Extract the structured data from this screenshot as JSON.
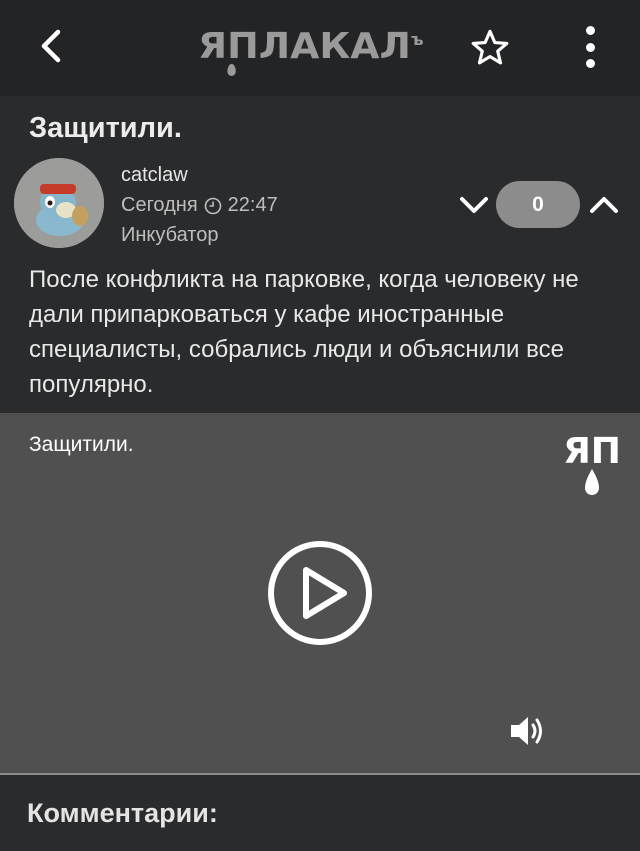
{
  "app": {
    "logo_text": "ЯПЛАКАЛ",
    "logo_suffix": "ъ"
  },
  "post": {
    "title": "Защитили.",
    "author": "catclaw",
    "date": "Сегодня",
    "time": "22:47",
    "rank": "Инкубатор",
    "score": "0",
    "text": "После конфликта на парковке, когда человеку не дали припарковаться у кафе иностранные специалисты, собрались люди и объяснили все популярно."
  },
  "video": {
    "title": "Защитили.",
    "logo_text": "ЯП"
  },
  "comments": {
    "title": "Комментарии:"
  },
  "icons": {
    "back": "chevron-left-icon",
    "favorite": "star-icon",
    "menu": "vertical-dots-icon",
    "clock": "clock-icon",
    "vote_down": "chevron-down-icon",
    "vote_up": "chevron-up-icon",
    "play": "play-circle-icon",
    "volume": "speaker-icon"
  },
  "colors": {
    "background": "#2a2b2d",
    "topbar": "#232426",
    "video_bg": "#505050",
    "score_pill": "#8c8c8c"
  }
}
